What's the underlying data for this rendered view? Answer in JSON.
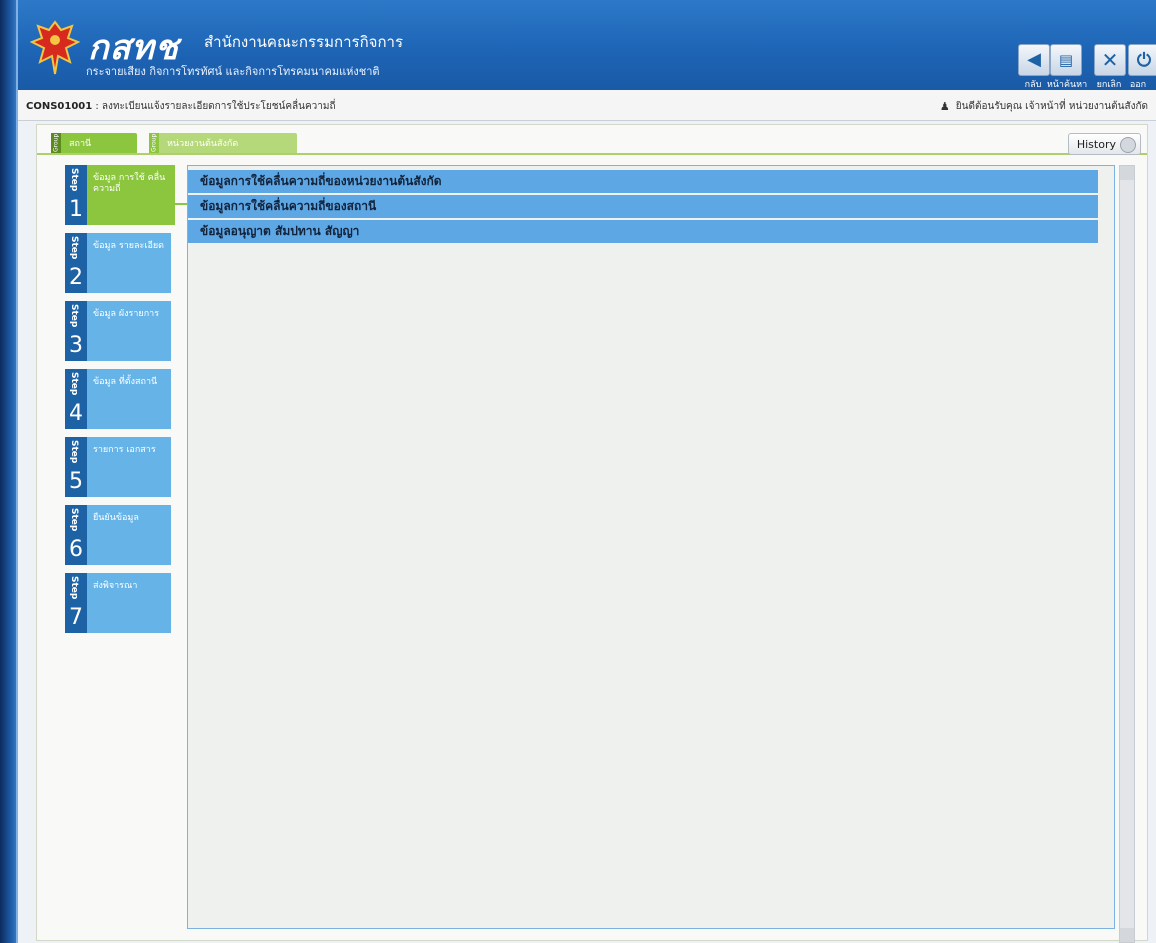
{
  "header": {
    "brand": "กสทช",
    "org_name": "สำนักงานคณะกรรมการกิจการ",
    "sub_name": "กระจายเสียง กิจการโทรทัศน์ และกิจการโทรคมนาคมแห่งชาติ",
    "toolbar": [
      {
        "label": "กลับ",
        "icon": "back-arrow-icon"
      },
      {
        "label": "หน้าค้นหา",
        "icon": "search-page-icon"
      },
      {
        "label": "ยกเลิก",
        "icon": "close-icon"
      },
      {
        "label": "ออก",
        "icon": "power-icon"
      }
    ]
  },
  "infobar": {
    "screen_code": "CONS01001",
    "screen_title": " : ลงทะเบียนแจ้งรายละเอียดการใช้ประโยชน์คลื่นความถี่",
    "welcome": "ยินดีต้อนรับคุณ เจ้าหน้าที่ หน่วยงานต้นสังกัด"
  },
  "tabs": [
    {
      "group": "Group",
      "label": "สถานี",
      "color": "#8cc63f"
    },
    {
      "group": "Group",
      "label": "หน่วยงานต้นสังกัด",
      "color": "#b5d97a"
    }
  ],
  "history_label": "History",
  "steps": [
    {
      "word": "Step",
      "num": "1",
      "label": "ข้อมูล การใช้ คลื่นความถี่",
      "active": true
    },
    {
      "word": "Step",
      "num": "2",
      "label": "ข้อมูล รายละเอียด",
      "active": false
    },
    {
      "word": "Step",
      "num": "3",
      "label": "ข้อมูล ผังรายการ",
      "active": false
    },
    {
      "word": "Step",
      "num": "4",
      "label": "ข้อมูล ที่ตั้งสถานี",
      "active": false
    },
    {
      "word": "Step",
      "num": "5",
      "label": "รายการ เอกสาร",
      "active": false
    },
    {
      "word": "Step",
      "num": "6",
      "label": "ยืนยันข้อมูล",
      "active": false
    },
    {
      "word": "Step",
      "num": "7",
      "label": "ส่งพิจารณา",
      "active": false
    }
  ],
  "sections": [
    "ข้อมูลการใช้คลื่นความถี่ของหน่วยงานต้นสังกัด",
    "ข้อมูลการใช้คลื่นความถี่ของสถานี",
    "ข้อมูลอนุญาต สัมปทาน สัญญา"
  ],
  "colors": {
    "header": "#1e65b6",
    "step_active": "#8cc63f",
    "step": "#66b3e8",
    "row": "#5ea7e5"
  }
}
